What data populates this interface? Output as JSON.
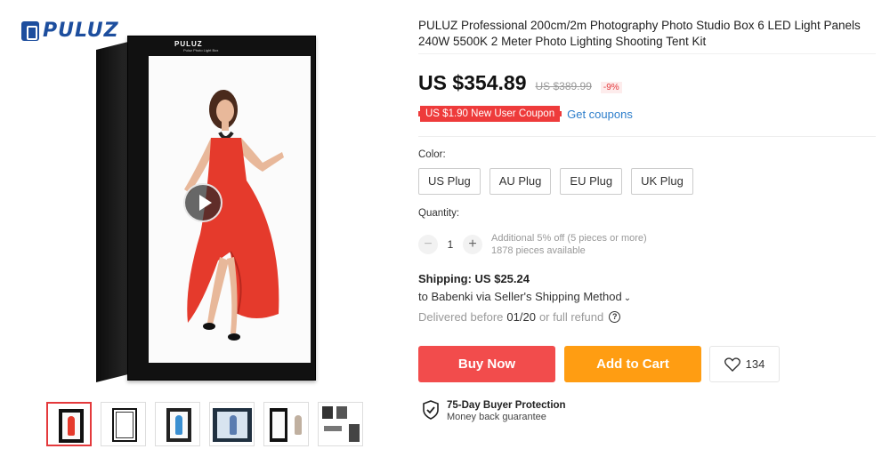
{
  "brand": {
    "name": "PULUZ"
  },
  "gallery": {
    "box_logo": "PULUZ",
    "box_sublogo": "Puluz Photo Light Box",
    "thumbnails": [
      "thumb-1",
      "thumb-2",
      "thumb-3",
      "thumb-4",
      "thumb-5",
      "thumb-6"
    ],
    "active_thumbnail": 0
  },
  "product": {
    "title": "PULUZ Professional 200cm/2m Photography Photo Studio Box 6 LED Light Panels 240W 5500K 2 Meter Photo Lighting Shooting Tent Kit",
    "price": "US $354.89",
    "old_price": "US $389.99",
    "discount": "-9%",
    "coupon": "US $1.90 New User Coupon",
    "get_coupons": "Get coupons"
  },
  "color": {
    "label": "Color:",
    "options": [
      "US Plug",
      "AU Plug",
      "EU Plug",
      "UK Plug"
    ]
  },
  "quantity": {
    "label": "Quantity:",
    "minus": "−",
    "value": "1",
    "plus": "+",
    "note1": "Additional 5% off (5 pieces or more)",
    "note2": "1878 pieces available"
  },
  "shipping": {
    "line1": "Shipping: US $25.24",
    "line2": "to Babenki via Seller's Shipping Method",
    "chev": "⌄",
    "delivered_prefix": "Delivered before",
    "delivered_date": "01/20",
    "delivered_suffix": "or full refund",
    "help": "?"
  },
  "actions": {
    "buy_now": "Buy Now",
    "add_to_cart": "Add to Cart",
    "wishlist_count": "134"
  },
  "protection": {
    "title": "75-Day Buyer Protection",
    "subtitle": "Money back guarantee"
  },
  "colors": {
    "buy_now": "#f24c4c",
    "add_to_cart": "#ff9d12",
    "coupon": "#ee3b3b",
    "link": "#2d7ecb",
    "brand": "#1d4e9e"
  }
}
